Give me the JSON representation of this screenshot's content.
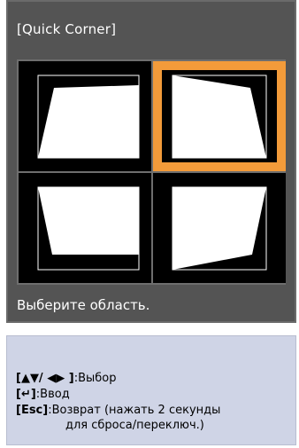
{
  "title": "[Quick Corner]",
  "status": "Выберите область.",
  "selected_cell": "top-right",
  "colors": {
    "panel_bg": "#545454",
    "selection": "#f39b3a",
    "help_bg": "#cfd4e6"
  },
  "help": {
    "select_keys": "[▲▼/ ◀▶ ]",
    "select_text": ":Выбор",
    "enter_key": "[↵]",
    "enter_text": ":Ввод",
    "esc_key": "[Esc]",
    "esc_text": ":Возврат (нажать 2 секунды",
    "esc_text_cont": "для сброса/переключ.)"
  }
}
